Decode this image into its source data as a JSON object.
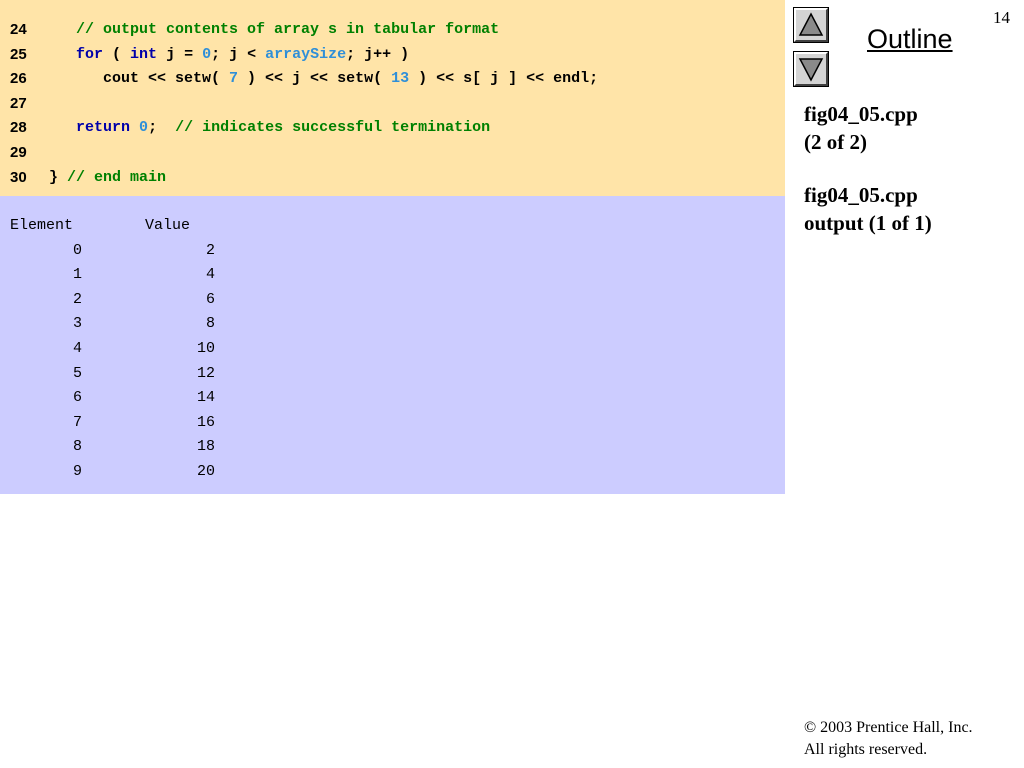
{
  "slide_number": "14",
  "outline": {
    "title": "Outline",
    "up_icon": "triangle-up-icon",
    "down_icon": "triangle-down-icon",
    "file_label_1": "fig04_05.cpp",
    "part_label_1": "(2 of 2)",
    "file_label_2": "fig04_05.cpp",
    "part_label_2": "output (1 of 1)"
  },
  "code_lines": [
    {
      "num": "24",
      "segments": [
        {
          "t": "   ",
          "c": ""
        },
        {
          "t": "// output contents of array s in tabular format",
          "c": "cmt"
        }
      ]
    },
    {
      "num": "25",
      "segments": [
        {
          "t": "   ",
          "c": ""
        },
        {
          "t": "for",
          "c": "kw"
        },
        {
          "t": " ( ",
          "c": ""
        },
        {
          "t": "int",
          "c": "kw"
        },
        {
          "t": " j = ",
          "c": ""
        },
        {
          "t": "0",
          "c": "num"
        },
        {
          "t": "; j < ",
          "c": ""
        },
        {
          "t": "arraySize",
          "c": "num"
        },
        {
          "t": "; j++ )",
          "c": ""
        }
      ]
    },
    {
      "num": "26",
      "segments": [
        {
          "t": "      cout << setw( ",
          "c": ""
        },
        {
          "t": "7",
          "c": "num"
        },
        {
          "t": " ) << j << setw( ",
          "c": ""
        },
        {
          "t": "13",
          "c": "num"
        },
        {
          "t": " ) << s[ j ] << endl;",
          "c": ""
        }
      ]
    },
    {
      "num": "27",
      "segments": []
    },
    {
      "num": "28",
      "segments": [
        {
          "t": "   ",
          "c": ""
        },
        {
          "t": "return",
          "c": "kw"
        },
        {
          "t": " ",
          "c": ""
        },
        {
          "t": "0",
          "c": "num"
        },
        {
          "t": ";  ",
          "c": ""
        },
        {
          "t": "// indicates successful termination",
          "c": "cmt"
        }
      ]
    },
    {
      "num": "29",
      "segments": []
    },
    {
      "num": "30",
      "segments": [
        {
          "t": "} ",
          "c": ""
        },
        {
          "t": "// end main",
          "c": "cmt"
        }
      ]
    }
  ],
  "output": {
    "header": "Element        Value",
    "rows": [
      {
        "element": "0",
        "value": "2"
      },
      {
        "element": "1",
        "value": "4"
      },
      {
        "element": "2",
        "value": "6"
      },
      {
        "element": "3",
        "value": "8"
      },
      {
        "element": "4",
        "value": "10"
      },
      {
        "element": "5",
        "value": "12"
      },
      {
        "element": "6",
        "value": "14"
      },
      {
        "element": "7",
        "value": "16"
      },
      {
        "element": "8",
        "value": "18"
      },
      {
        "element": "9",
        "value": "20"
      }
    ]
  },
  "copyright": {
    "line1": "© 2003 Prentice Hall, Inc.",
    "line2": "All rights reserved."
  }
}
